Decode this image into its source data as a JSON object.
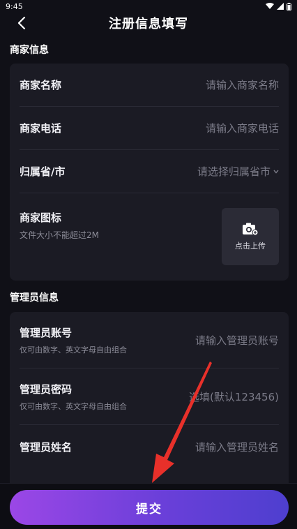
{
  "status_bar": {
    "time": "9:45"
  },
  "header": {
    "title": "注册信息填写"
  },
  "merchant_section": {
    "title": "商家信息",
    "name": {
      "label": "商家名称",
      "placeholder": "请输入商家名称"
    },
    "phone": {
      "label": "商家电话",
      "placeholder": "请输入商家电话"
    },
    "region": {
      "label": "归属省/市",
      "placeholder": "请选择归属省市"
    },
    "logo": {
      "label": "商家图标",
      "hint": "文件大小不能超过2M",
      "upload_label": "点击上传"
    }
  },
  "admin_section": {
    "title": "管理员信息",
    "account": {
      "label": "管理员账号",
      "hint": "仅可由数字、英文字母自由组合",
      "placeholder": "请输入管理员账号"
    },
    "password": {
      "label": "管理员密码",
      "hint": "仅可由数字、英文字母自由组合",
      "placeholder": "选填(默认123456)"
    },
    "name": {
      "label": "管理员姓名",
      "placeholder": "请输入管理员姓名"
    }
  },
  "footer": {
    "submit_label": "提交"
  },
  "colors": {
    "accent_start": "#9b47e6",
    "accent_end": "#4e3fcf",
    "arrow": "#e8302a",
    "background": "#101017",
    "card": "#1b1b24"
  }
}
